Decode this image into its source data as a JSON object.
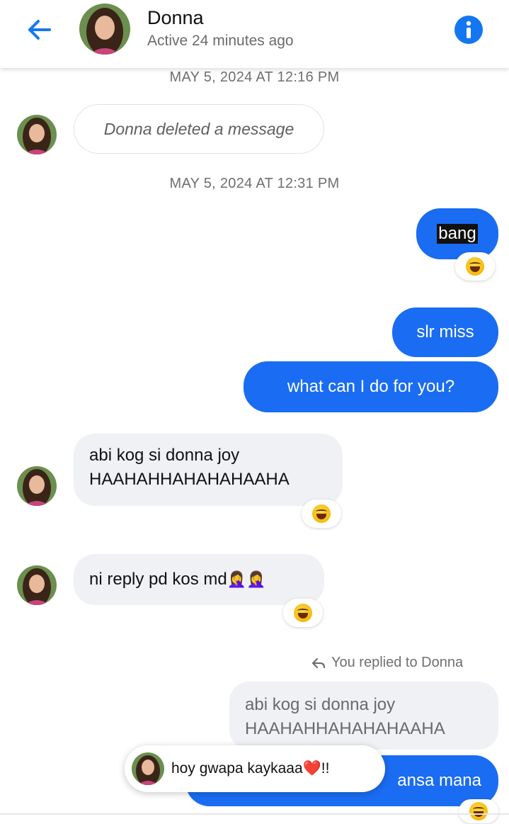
{
  "header": {
    "name": "Donna",
    "status": "Active 24 minutes ago",
    "back_icon": "arrow-left-icon",
    "info_icon": "info-icon"
  },
  "timestamps": [
    "MAY 5, 2024 AT 12:16 PM",
    "MAY 5, 2024 AT 12:31 PM"
  ],
  "messages": {
    "deleted": "Donna deleted a message",
    "out_bang": "bang",
    "out_slr": "slr miss",
    "out_what": "what can I do for you?",
    "in_abi_line1": "abi kog si donna joy",
    "in_abi_line2": "HAAHAHHAHAHAHAAHA",
    "in_ni": "ni reply pd kos md",
    "in_ni_emoji": "🤦‍♀️🤦‍♀️",
    "reply_indicator": "You replied to Donna",
    "quoted_line1": "abi kog si donna joy",
    "quoted_line2": "HAAHAHHAHAHAHAAHA",
    "partial_reply": "ansa mana"
  },
  "reaction_icon": "laughing-face-icon",
  "toast": {
    "text": "hoy gwapa kaykaaa",
    "heart": "❤️",
    "suffix": "!!"
  },
  "colors": {
    "accent": "#1a6cf2",
    "incoming_bg": "#f0f1f5"
  }
}
